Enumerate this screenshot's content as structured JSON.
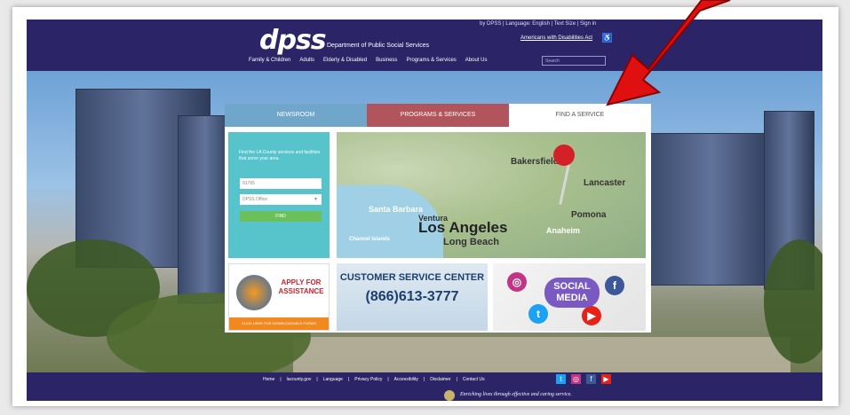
{
  "header": {
    "logo": "dpss",
    "department": "Department of Public Social Services",
    "topline": "by DPSS | Language: English | Text Size | Sign in",
    "ada_link": "Americans with Disabilities Act",
    "nav": [
      "Family & Children",
      "Adults",
      "Elderly & Disabled",
      "Business",
      "Programs & Services",
      "About Us"
    ],
    "search_placeholder": "Search"
  },
  "tabs": [
    "NEWSROOM",
    "PROGRAMS & SERVICES",
    "FIND A SERVICE"
  ],
  "finder": {
    "text": "Find the LA County services and facilities that serve your area.",
    "zip_placeholder": "91765",
    "office_select": "DPSS Office",
    "find_button": "FIND"
  },
  "map": {
    "labels": [
      "Bakersfield",
      "Lancaster",
      "Santa Barbara",
      "Ventura",
      "Los Angeles",
      "Pomona",
      "Anaheim",
      "Long Beach",
      "Channel Islands"
    ]
  },
  "promos": {
    "apply": {
      "text": "APPLY FOR ASSISTANCE",
      "badge": "Apply Now",
      "bar": "CLICK HERE FOR DOWNLOADABLE FORMS"
    },
    "csc": {
      "title": "CUSTOMER SERVICE CENTER",
      "phone": "(866)613-3777"
    },
    "social": {
      "title": "SOCIAL MEDIA"
    }
  },
  "footer": {
    "links": [
      "Home",
      "|",
      "lacounty.gov",
      "|",
      "Language",
      "|",
      "Privacy Policy",
      "|",
      "Accessibility",
      "|",
      "Disclaimer",
      "|",
      "Contact Us"
    ],
    "tagline": "Enriching lives through effective and caring service."
  },
  "colors": {
    "navy": "#2b2466",
    "teal": "#57c3cb",
    "rose": "#b2545b",
    "arrow": "#e01010"
  }
}
